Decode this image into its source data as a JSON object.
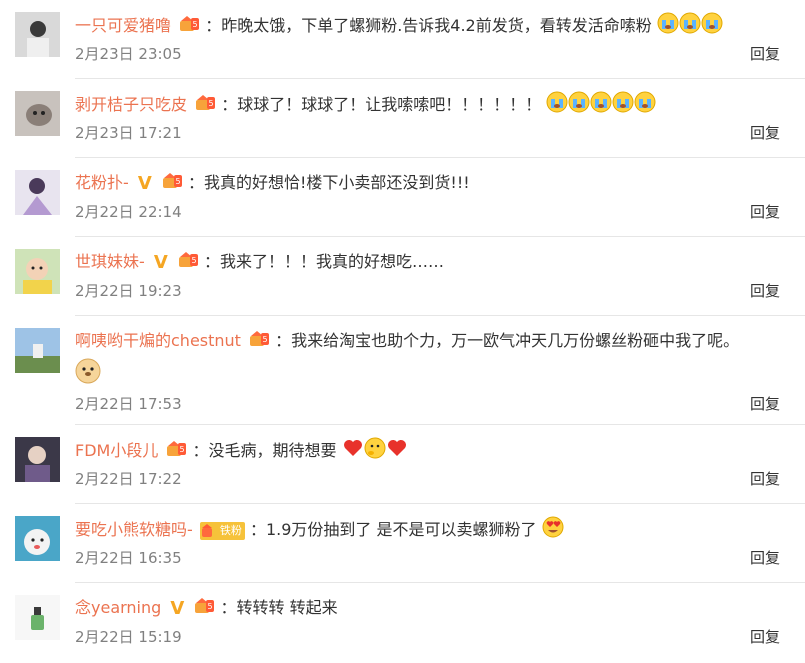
{
  "comments": [
    {
      "name": "一只可爱猪噜",
      "verified": false,
      "fan_badge": "",
      "text": "：昨晚太饿，下单了螺狮粉.告诉我4.2前发货，看转发活命嗦粉",
      "emojis": [
        "cry-emoji",
        "cry-emoji",
        "cry-emoji"
      ],
      "date": "2月23日 23:05",
      "reply": "回复"
    },
    {
      "name": "剥开桔子只吃皮",
      "verified": false,
      "fan_badge": "",
      "text": "：球球了！球球了！让我嗦嗦吧！！！！！！",
      "emojis": [
        "cry-emoji",
        "cry-emoji",
        "cry-emoji",
        "cry-emoji",
        "cry-emoji"
      ],
      "date": "2月23日 17:21",
      "reply": "回复"
    },
    {
      "name": "花粉扑-",
      "verified": true,
      "fan_badge": "",
      "text": "：我真的好想恰!楼下小卖部还没到货!!!",
      "emojis": [],
      "date": "2月22日 22:14",
      "reply": "回复"
    },
    {
      "name": "世琪妹妹-",
      "verified": true,
      "fan_badge": "",
      "text": "：我来了！！！我真的好想吃……",
      "emojis": [],
      "date": "2月22日 19:23",
      "reply": "回复"
    },
    {
      "name": "啊咦哟干煸的chestnut",
      "verified": false,
      "fan_badge": "",
      "text": "：我来给淘宝也助个力，万一欧气冲天几万份螺丝粉砸中我了呢。",
      "emojis": [
        "doge-emoji"
      ],
      "date": "2月22日 17:53",
      "reply": "回复"
    },
    {
      "name": "FDM小段儿",
      "verified": false,
      "fan_badge": "",
      "text": "：没毛病，期待想要",
      "emojis": [
        "heart-emoji",
        "hug-emoji",
        "heart-emoji"
      ],
      "date": "2月22日 17:22",
      "reply": "回复"
    },
    {
      "name": "要吃小熊软糖吗-",
      "verified": false,
      "fan_badge": "铁粉",
      "text": "：1.9万份抽到了 是不是可以卖螺狮粉了",
      "emojis": [
        "heart-eyes-emoji"
      ],
      "date": "2月22日 16:35",
      "reply": "回复"
    },
    {
      "name": "念yearning",
      "verified": true,
      "fan_badge": "",
      "text": "：转转转 转起来",
      "emojis": [],
      "date": "2月22日 15:19",
      "reply": "回复"
    }
  ],
  "colors": {
    "name": "#eb7350",
    "date": "#808080",
    "text": "#333333",
    "divider": "#e6e6e6",
    "verified": "#f5a623"
  }
}
